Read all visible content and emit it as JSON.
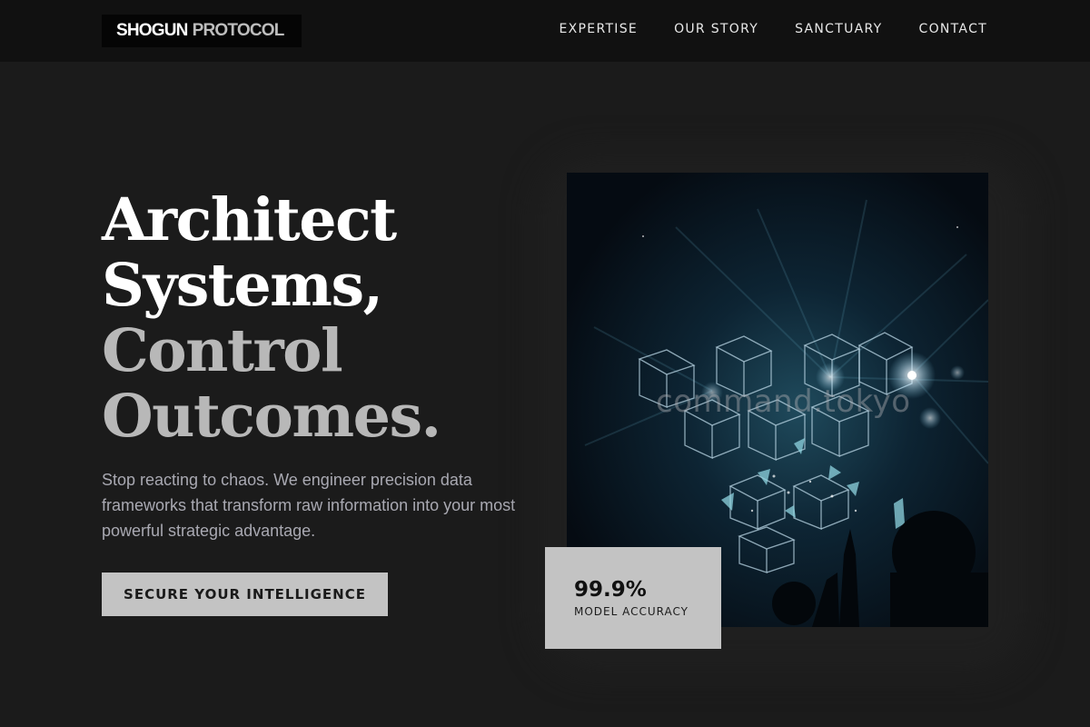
{
  "brand": {
    "name_primary": "SHOGUN",
    "name_secondary": "PROTOCOL"
  },
  "nav": {
    "items": [
      {
        "label": "EXPERTISE"
      },
      {
        "label": "OUR STORY"
      },
      {
        "label": "SANCTUARY"
      },
      {
        "label": "CONTACT"
      }
    ]
  },
  "hero": {
    "headline": {
      "line1": "Architect",
      "line2": "Systems,",
      "line3": "Control",
      "line4": "Outcomes."
    },
    "description": "Stop reacting to chaos. We engineer precision data frameworks that transform raw information into your most powerful strategic advantage.",
    "cta_label": "SECURE YOUR INTELLIGENCE"
  },
  "visual": {
    "subject": "glowing wireframe cube installation",
    "watermark": "command.tokyo"
  },
  "stat": {
    "value": "99.9%",
    "label": "MODEL ACCURACY"
  },
  "colors": {
    "page_background": "#1b1b1b",
    "header_background": "#111111",
    "headline_primary": "#ffffff",
    "headline_muted": "#b8b8b8",
    "body_text": "#a9a9b2",
    "button_background": "#c3c3c3",
    "stat_card_background": "#c3c3c3"
  }
}
